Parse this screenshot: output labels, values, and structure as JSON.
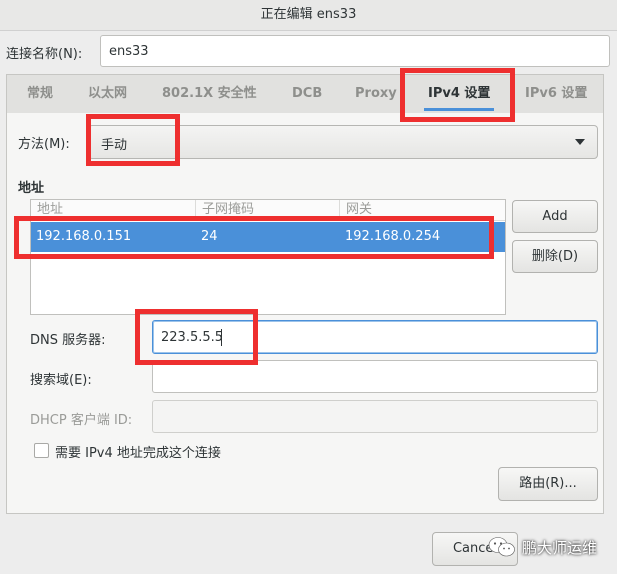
{
  "window": {
    "title": "正在编辑 ens33"
  },
  "connection_name": {
    "label": "连接名称(N):",
    "value": "ens33"
  },
  "tabs": [
    {
      "label": "常规"
    },
    {
      "label": "以太网"
    },
    {
      "label": "802.1X 安全性"
    },
    {
      "label": "DCB"
    },
    {
      "label": "Proxy"
    },
    {
      "label": "IPv4 设置",
      "active": true
    },
    {
      "label": "IPv6 设置"
    }
  ],
  "method": {
    "label": "方法(M):",
    "value": "手动",
    "icon": "dropdown-arrow-icon"
  },
  "addresses": {
    "section_label": "地址",
    "columns": [
      "地址",
      "子网掩码",
      "网关"
    ],
    "rows": [
      {
        "address": "192.168.0.151",
        "netmask": "24",
        "gateway": "192.168.0.254"
      }
    ],
    "add_button": "Add",
    "delete_button": "删除(D)"
  },
  "dns": {
    "label": "DNS 服务器:",
    "value": "223.5.5.5"
  },
  "search_domains": {
    "label": "搜索域(E):",
    "value": ""
  },
  "dhcp_client_id": {
    "label": "DHCP 客户端 ID:",
    "value": ""
  },
  "require_ipv4": {
    "label": "需要 IPv4 地址完成这个连接",
    "checked": false
  },
  "routes_button": "路由(R)...",
  "footer": {
    "cancel_button": "Cancel"
  },
  "watermark": {
    "text": "鹏大师运维",
    "icon": "wechat-icon"
  },
  "colors": {
    "accent": "#4a90d9",
    "highlight_box": "#ee2f2f"
  }
}
